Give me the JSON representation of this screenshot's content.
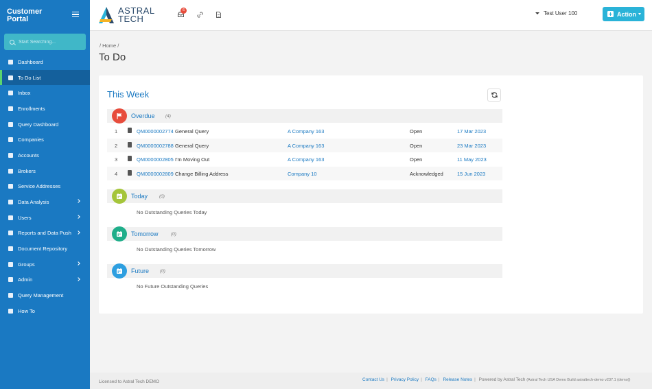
{
  "sidebar": {
    "brand_line1": "Customer",
    "brand_line2": "Portal",
    "search_placeholder": "Start Searching...",
    "items": [
      {
        "label": "Dashboard",
        "icon": "dashboard-icon"
      },
      {
        "label": "To Do List",
        "icon": "list-icon",
        "active": true
      },
      {
        "label": "Inbox",
        "icon": "inbox-icon"
      },
      {
        "label": "Enrollments",
        "icon": "id-card-icon"
      },
      {
        "label": "Query Dashboard",
        "icon": "megaphone-icon"
      },
      {
        "label": "Companies",
        "icon": "building-icon"
      },
      {
        "label": "Accounts",
        "icon": "building-icon"
      },
      {
        "label": "Brokers",
        "icon": "building-icon"
      },
      {
        "label": "Service Addresses",
        "icon": "map-marker-icon"
      },
      {
        "label": "Data Analysis",
        "icon": "chart-icon",
        "expandable": true
      },
      {
        "label": "Users",
        "icon": "users-icon",
        "expandable": true
      },
      {
        "label": "Reports and Data Push",
        "icon": "file-icon",
        "expandable": true
      },
      {
        "label": "Document Repository",
        "icon": "file-icon"
      },
      {
        "label": "Groups",
        "icon": "layers-icon",
        "expandable": true
      },
      {
        "label": "Admin",
        "icon": "wrench-icon",
        "expandable": true
      },
      {
        "label": "Query Management",
        "icon": "question-icon"
      },
      {
        "label": "How To",
        "icon": "file-icon"
      }
    ]
  },
  "topbar": {
    "logo_line1": "ASTRAL",
    "logo_line2": "TECH",
    "inbox_badge": "6",
    "user_name": "Test User 100",
    "action_label": "Action"
  },
  "breadcrumb": "/ Home /",
  "page_title": "To Do",
  "panel": {
    "title": "This Week",
    "sections": {
      "overdue": {
        "name": "Overdue",
        "count": "(4)",
        "color": "#e74c3c"
      },
      "today": {
        "name": "Today",
        "count": "(0)",
        "empty": "No Outstanding Queries Today",
        "color": "#a5c53a"
      },
      "tomorrow": {
        "name": "Tomorrow",
        "count": "(0)",
        "empty": "No Outstanding Queries Tomorrow",
        "color": "#1fae8a"
      },
      "future": {
        "name": "Future",
        "count": "(0)",
        "empty": "No Future Outstanding Queries",
        "color": "#2e9fe0"
      }
    },
    "overdue_rows": [
      {
        "num": "1",
        "ref": "QM0000002774",
        "title": "General Query",
        "company": "A Company 163",
        "status": "Open",
        "date": "17 Mar 2023"
      },
      {
        "num": "2",
        "ref": "QM0000002788",
        "title": "General Query",
        "company": "A Company 163",
        "status": "Open",
        "date": "23 Mar 2023"
      },
      {
        "num": "3",
        "ref": "QM0000002805",
        "title": "I'm Moving Out",
        "company": "A Company 163",
        "status": "Open",
        "date": "11 May 2023"
      },
      {
        "num": "4",
        "ref": "QM0000002809",
        "title": "Change Billing Address",
        "company": "Company 10",
        "status": "Acknowledged",
        "date": "15 Jun 2023"
      }
    ]
  },
  "footer": {
    "license": "Licensed to Astral Tech DEMO",
    "links": [
      "Contact Us",
      "Privacy Policy",
      "FAQs",
      "Release Notes"
    ],
    "powered": "Powered by Astral Tech",
    "build": "(Astral Tech USA Demo Build astraltech-demo v237.1 (demo))"
  }
}
